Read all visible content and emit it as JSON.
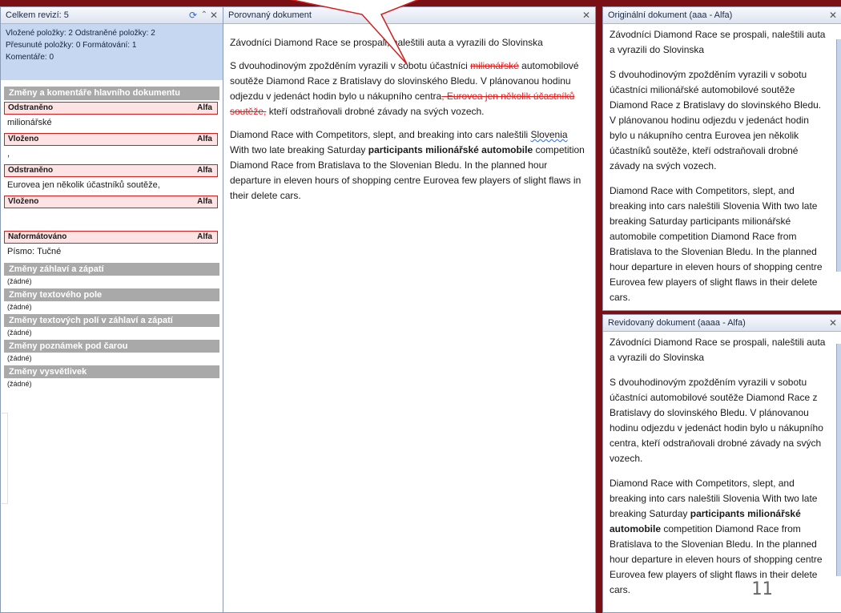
{
  "left_pane": {
    "title": "Celkem revizí: 5",
    "summary": {
      "line1": "Vložené položky: 2  Odstraněné položky: 2",
      "line2": "Přesunuté položky: 0  Formátování: 1",
      "line3": "Komentáře: 0"
    },
    "main_section": "Změny a komentáře hlavního dokumentu",
    "changes": [
      {
        "type": "Odstraněno",
        "author": "Alfa",
        "text": "milionářské"
      },
      {
        "type": "Vloženo",
        "author": "Alfa",
        "text": ","
      },
      {
        "type": "Odstraněno",
        "author": "Alfa",
        "text": " Eurovea jen několik účastníků soutěže,"
      },
      {
        "type": "Vloženo",
        "author": "Alfa",
        "text": ""
      },
      {
        "type": "Naformátováno",
        "author": "Alfa",
        "text": "Písmo: Tučné"
      }
    ],
    "sections": [
      {
        "title": "Změny záhlaví a zápatí",
        "value": "(žádné)"
      },
      {
        "title": "Změny textového pole",
        "value": "(žádné)"
      },
      {
        "title": "Změny textových polí v záhlaví a zápatí",
        "value": "(žádné)"
      },
      {
        "title": "Změny poznámek pod čarou",
        "value": "(žádné)"
      },
      {
        "title": "Změny vysvětlivek",
        "value": "(žádné)"
      }
    ]
  },
  "compared": {
    "title": "Porovnaný dokument",
    "p1": "Závodníci Diamond Race se prospali, naleštili auta a vyrazili do Slovinska",
    "p2a": "S dvouhodinovým zpožděním vyrazili v sobotu účastníci ",
    "p2del1": "milionářské",
    "p2b": " automobilové soutěže Diamond Race z Bratislavy do slovinského Bledu. V plánovanou hodinu odjezdu v jedenáct hodin bylo u nákupního centra",
    "p2del2": ", Eurovea jen několik účastníků soutěže,",
    "p2c": " kteří odstraňovali drobné závady na svých vozech.",
    "p3a": "Diamond Race with Competitors, slept, and breaking into cars naleštili ",
    "p3squig": "Slovenia",
    "p3b": " With two late breaking Saturday ",
    "p3bold": "participants milionářské automobile",
    "p3c": " competition Diamond Race from Bratislava to the Slovenian Bledu. In the planned hour departure in eleven hours of shopping centre Eurovea few players of slight flaws in their delete cars."
  },
  "original": {
    "title": "Originální dokument (aaa - Alfa)",
    "p1": "Závodníci Diamond Race se prospali, naleštili auta a vyrazili do Slovinska",
    "p2": "S dvouhodinovým zpožděním vyrazili v sobotu účastníci milionářské automobilové soutěže Diamond Race z Bratislavy do slovinského Bledu. V plánovanou hodinu odjezdu v jedenáct hodin bylo u nákupního centra Eurovea jen několik účastníků soutěže, kteří odstraňovali drobné závady na svých vozech.",
    "p3": "Diamond Race with Competitors, slept, and breaking into cars naleštili Slovenia With two late breaking Saturday participants milionářské automobile competition Diamond Race from Bratislava to the Slovenian Bledu. In the planned hour departure in eleven hours of shopping centre Eurovea few players of slight flaws in their delete cars."
  },
  "revised": {
    "title": "Revidovaný dokument (aaaa - Alfa)",
    "p1": "Závodníci Diamond Race se prospali, naleštili auta a vyrazili do Slovinska",
    "p2": "S dvouhodinovým zpožděním vyrazili v sobotu účastníci automobilové soutěže Diamond Race z Bratislavy do slovinského Bledu. V plánovanou hodinu odjezdu v jedenáct hodin bylo u nákupního centra, kteří odstraňovali drobné závady na svých vozech.",
    "p3a": "Diamond Race with Competitors, slept, and breaking into cars naleštili Slovenia  With two late breaking Saturday ",
    "p3bold": "participants milionářské automobile",
    "p3b": " competition Diamond Race from Bratislava to the Slovenian Bledu. In the planned hour departure in eleven hours of shopping centre Eurovea few players of slight flaws in their delete cars.",
    "page_number": "11"
  },
  "icons": {
    "refresh": "refresh-icon",
    "collapse": "chevron-up-icon",
    "close": "close-icon"
  }
}
